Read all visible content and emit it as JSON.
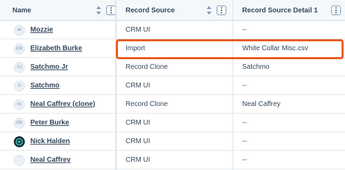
{
  "columns": {
    "name": "Name",
    "record_source": "Record Source",
    "record_source_detail": "Record Source Detail 1"
  },
  "rows": [
    {
      "initials": "M",
      "name": "Mozzie",
      "source": "CRM UI",
      "detail": "--"
    },
    {
      "initials": "EB",
      "name": "Elizabeth Burke",
      "source": "Import",
      "detail": "White Collar Misc.csv"
    },
    {
      "initials": "SJ",
      "name": "Satchmo Jr",
      "source": "Record Clone",
      "detail": "Satchmo"
    },
    {
      "initials": "S",
      "name": "Satchmo",
      "source": "CRM UI",
      "detail": "--"
    },
    {
      "initials": "N(",
      "name": "Neal Caffrey (clone)",
      "source": "Record Clone",
      "detail": "Neal Caffrey"
    },
    {
      "initials": "PB",
      "name": "Peter Burke",
      "source": "CRM UI",
      "detail": "--"
    },
    {
      "initials": "",
      "name": "Nick Halden",
      "source": "CRM UI",
      "detail": "--",
      "avatar_icon": "logo-avatar-icon"
    },
    {
      "initials": "",
      "name": "Neal Caffrey",
      "source": "CRM UI",
      "detail": "--"
    }
  ],
  "highlight_color": "#ea5a1e",
  "icons": {
    "sort": "sort-arrows-icon",
    "menu": "vertical-dots-icon"
  }
}
